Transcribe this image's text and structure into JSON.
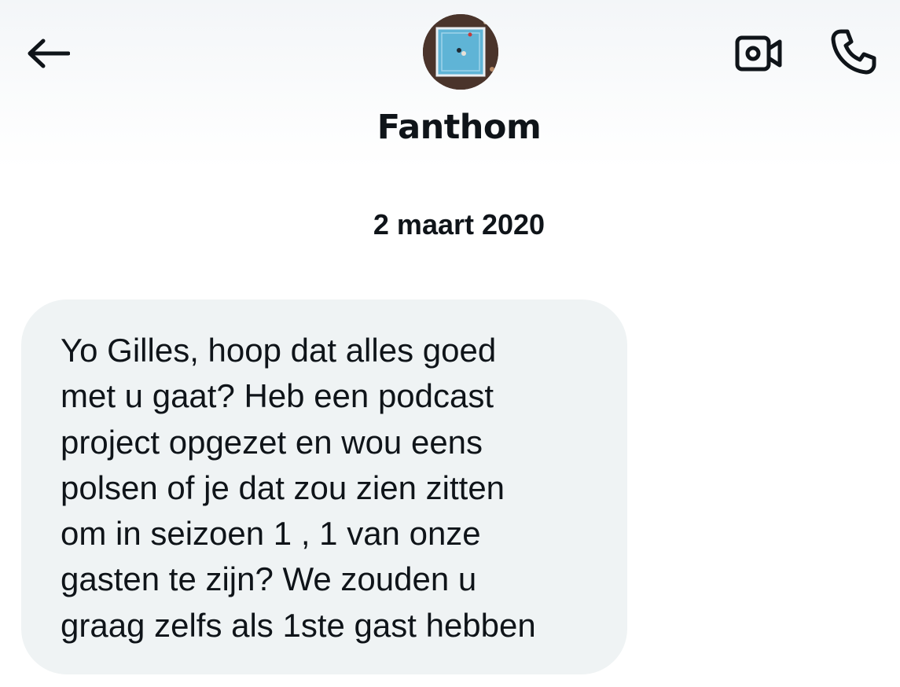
{
  "header": {
    "contact_name": "Fanthom",
    "icons": {
      "back": "arrow-left-icon",
      "video": "video-camera-icon",
      "call": "phone-icon",
      "avatar": "boxing-ring-avatar"
    }
  },
  "conversation": {
    "date": "2 maart 2020",
    "messages": [
      {
        "sender": "Fanthom",
        "direction": "incoming",
        "text": "Yo Gilles, hoop dat alles goed\nmet u gaat? Heb een podcast\nproject opgezet en wou eens\npolsen of je dat zou zien zitten\nom in seizoen 1 , 1 van onze\ngasten te zijn? We zouden u\ngraag zelfs als 1ste gast hebben"
      }
    ]
  },
  "colors": {
    "text": "#0f1419",
    "bubble": "#eff3f4",
    "background": "#ffffff"
  }
}
